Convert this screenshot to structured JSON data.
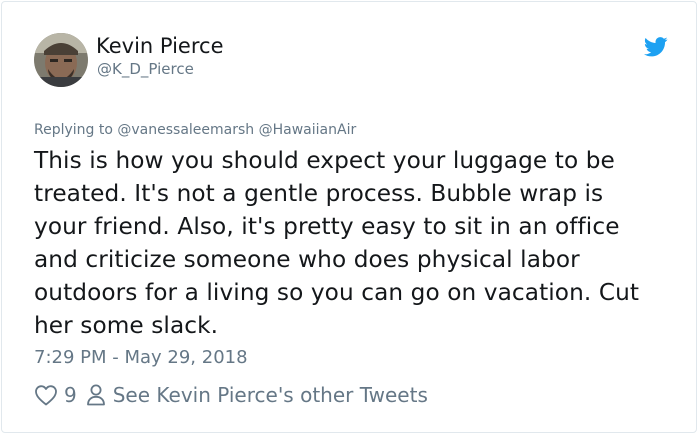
{
  "tweet": {
    "author": {
      "display_name": "Kevin Pierce",
      "handle": "@K_D_Pierce",
      "avatar_icon": "profile-photo"
    },
    "platform_icon": "twitter-bird-icon",
    "reply": {
      "prefix": "Replying to",
      "mentions": [
        "@vanessaleemarsh",
        "@HawaiianAir"
      ]
    },
    "text_lines": [
      "This is how you should expect your luggage to be",
      "treated. It's not a gentle process. Bubble wrap is",
      "your friend. Also, it's pretty easy to sit in an office",
      "and criticize someone who does physical labor",
      "outdoors for a living so you can go on vacation. Cut",
      "her some slack."
    ],
    "timestamp": "7:29 PM - May 29, 2018",
    "likes": "9",
    "other_tweets_label": "See Kevin Pierce's other Tweets"
  },
  "colors": {
    "twitter_blue": "#1da1f2",
    "text_primary": "#14171a",
    "text_secondary": "#657786",
    "border": "#e1e8ed"
  }
}
